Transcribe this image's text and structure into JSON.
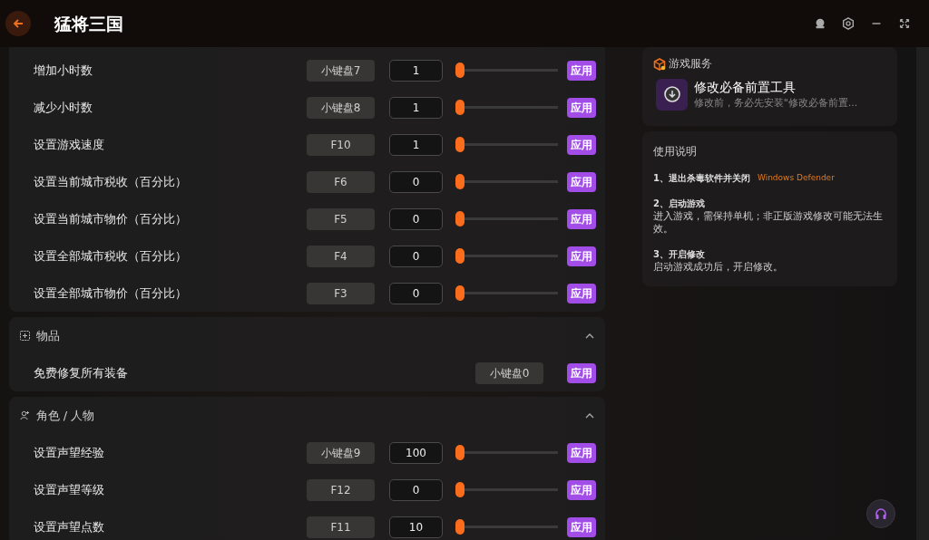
{
  "window": {
    "title": "猛将三国"
  },
  "sections": [
    {
      "kind": "plain",
      "rows": [
        {
          "kind": "slider",
          "label": "增加小时数",
          "hotkey": "小键盘7",
          "value": "1",
          "level": 0,
          "button": "应用"
        },
        {
          "kind": "slider",
          "label": "减少小时数",
          "hotkey": "小键盘8",
          "value": "1",
          "level": 0,
          "button": "应用"
        },
        {
          "kind": "slider",
          "label": "设置游戏速度",
          "hotkey": "F10",
          "value": "1",
          "level": 0,
          "button": "应用"
        },
        {
          "kind": "slider",
          "label": "设置当前城市税收（百分比）",
          "hotkey": "F6",
          "value": "0",
          "level": 0,
          "button": "应用"
        },
        {
          "kind": "slider",
          "label": "设置当前城市物价（百分比）",
          "hotkey": "F5",
          "value": "0",
          "level": 0,
          "button": "应用"
        },
        {
          "kind": "slider",
          "label": "设置全部城市税收（百分比）",
          "hotkey": "F4",
          "value": "0",
          "level": 0,
          "button": "应用"
        },
        {
          "kind": "slider",
          "label": "设置全部城市物价（百分比）",
          "hotkey": "F3",
          "value": "0",
          "level": 0,
          "button": "应用"
        }
      ]
    },
    {
      "kind": "items",
      "title": "物品",
      "expanded": true,
      "rows": [
        {
          "kind": "button",
          "label": "免费修复所有装备",
          "hotkey": "小键盘0",
          "button": "应用"
        }
      ]
    },
    {
      "kind": "character",
      "title": "角色 / 人物",
      "expanded": true,
      "rows": [
        {
          "kind": "slider",
          "label": "设置声望经验",
          "hotkey": "小键盘9",
          "value": "100",
          "level": 0,
          "button": "应用"
        },
        {
          "kind": "slider",
          "label": "设置声望等级",
          "hotkey": "F12",
          "value": "0",
          "level": 0,
          "button": "应用"
        },
        {
          "kind": "slider",
          "label": "设置声望点数",
          "hotkey": "F11",
          "value": "10",
          "level": 0,
          "button": "应用"
        }
      ]
    }
  ],
  "service": {
    "title": "游戏服务",
    "tool_name": "修改必备前置工具",
    "tool_desc": "修改前，务必先安装\"修改必备前置..."
  },
  "instructions": {
    "title": "使用说明",
    "steps": [
      {
        "heading": "1、退出杀毒软件并关闭",
        "highlight": "Windows Defender"
      },
      {
        "heading": "2、启动游戏",
        "text": "进入游戏，需保持单机；非正版游戏修改可能无法生效。"
      },
      {
        "heading": "3、开启修改",
        "text": "启动游戏成功后，开启修改。"
      }
    ]
  }
}
